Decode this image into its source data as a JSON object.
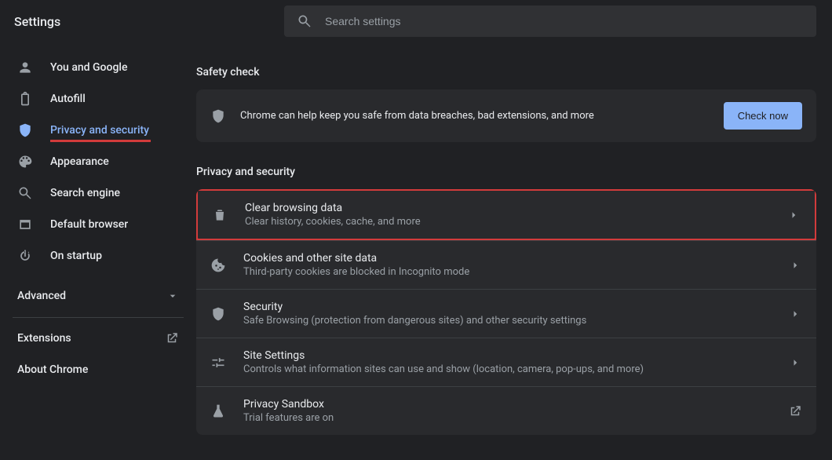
{
  "header": {
    "title": "Settings",
    "search_placeholder": "Search settings"
  },
  "sidebar": {
    "items": [
      {
        "id": "you-and-google",
        "label": "You and Google"
      },
      {
        "id": "autofill",
        "label": "Autofill"
      },
      {
        "id": "privacy",
        "label": "Privacy and security",
        "active": true
      },
      {
        "id": "appearance",
        "label": "Appearance"
      },
      {
        "id": "search-engine",
        "label": "Search engine"
      },
      {
        "id": "default-browser",
        "label": "Default browser"
      },
      {
        "id": "on-startup",
        "label": "On startup"
      }
    ],
    "advanced_label": "Advanced",
    "extensions_label": "Extensions",
    "about_label": "About Chrome"
  },
  "main": {
    "safety_check": {
      "title": "Safety check",
      "message": "Chrome can help keep you safe from data breaches, bad extensions, and more",
      "button": "Check now"
    },
    "privacy": {
      "title": "Privacy and security",
      "rows": [
        {
          "id": "clear-browsing-data",
          "title": "Clear browsing data",
          "sub": "Clear history, cookies, cache, and more",
          "highlight": true
        },
        {
          "id": "cookies",
          "title": "Cookies and other site data",
          "sub": "Third-party cookies are blocked in Incognito mode"
        },
        {
          "id": "security",
          "title": "Security",
          "sub": "Safe Browsing (protection from dangerous sites) and other security settings"
        },
        {
          "id": "site-settings",
          "title": "Site Settings",
          "sub": "Controls what information sites can use and show (location, camera, pop-ups, and more)"
        },
        {
          "id": "privacy-sandbox",
          "title": "Privacy Sandbox",
          "sub": "Trial features are on",
          "external": true
        }
      ]
    }
  }
}
